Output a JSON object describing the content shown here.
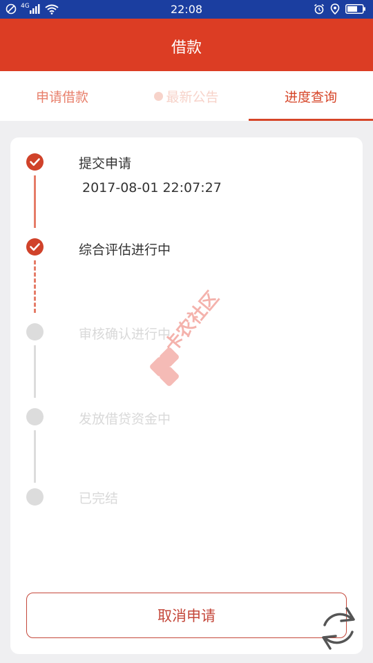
{
  "status_bar": {
    "time": "22:08",
    "network_label": "4G",
    "icons": [
      "do-not-disturb-icon",
      "signal-icon",
      "wifi-icon",
      "alarm-icon",
      "location-icon",
      "battery-icon"
    ]
  },
  "header": {
    "title": "借款"
  },
  "tabs": [
    {
      "label": "申请借款",
      "state": "normal"
    },
    {
      "label": "最新公告",
      "state": "disabled"
    },
    {
      "label": "进度查询",
      "state": "active"
    }
  ],
  "progress": {
    "steps": [
      {
        "label": "提交申请",
        "time": "2017-08-01 22:07:27",
        "status": "done"
      },
      {
        "label": "综合评估进行中",
        "status": "done"
      },
      {
        "label": "审核确认进行中",
        "status": "pending"
      },
      {
        "label": "发放借贷资金中",
        "status": "pending"
      },
      {
        "label": "已完结",
        "status": "pending"
      }
    ]
  },
  "actions": {
    "cancel_label": "取消申请"
  },
  "watermark": {
    "text": "卡农社区"
  },
  "colors": {
    "status_bar": "#1b3ea0",
    "brand_red": "#dc3d24",
    "done": "#d0422a",
    "pending": "#dcdcdc",
    "background": "#efeff1"
  }
}
